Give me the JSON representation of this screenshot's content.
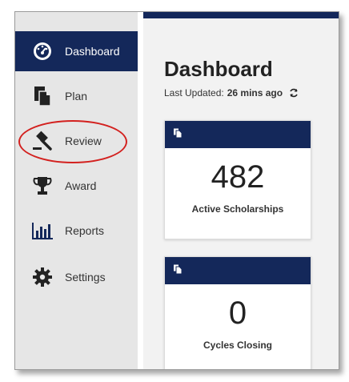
{
  "sidebar": {
    "items": [
      {
        "label": "Dashboard",
        "icon": "dashboard-gauge-icon",
        "active": true
      },
      {
        "label": "Plan",
        "icon": "documents-icon",
        "active": false
      },
      {
        "label": "Review",
        "icon": "gavel-icon",
        "active": false
      },
      {
        "label": "Award",
        "icon": "trophy-icon",
        "active": false
      },
      {
        "label": "Reports",
        "icon": "bar-chart-icon",
        "active": false
      },
      {
        "label": "Settings",
        "icon": "gear-icon",
        "active": false
      }
    ]
  },
  "main": {
    "title": "Dashboard",
    "last_updated_label": "Last Updated:",
    "last_updated_value": "26 mins ago",
    "refresh_icon": "refresh-icon",
    "cards": [
      {
        "value": "482",
        "caption": "Active Scholarships",
        "icon": "documents-icon"
      },
      {
        "value": "0",
        "caption": "Cycles Closing",
        "icon": "documents-icon"
      }
    ]
  },
  "colors": {
    "navy": "#14285a",
    "sidebar_bg": "#e6e6e6",
    "highlight": "#d3211f"
  }
}
